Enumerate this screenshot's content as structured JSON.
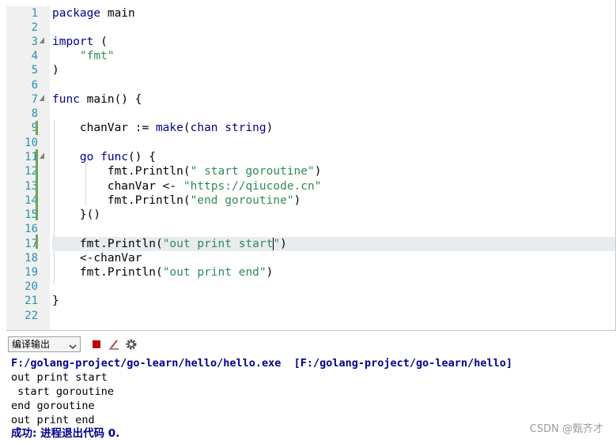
{
  "editor": {
    "line_numbers": [
      "1",
      "2",
      "3",
      "4",
      "5",
      "6",
      "7",
      "8",
      "9",
      "10",
      "11",
      "12",
      "13",
      "14",
      "15",
      "16",
      "17",
      "18",
      "19",
      "20",
      "21",
      "22"
    ],
    "line1": {
      "kw": "package",
      "rest": " main"
    },
    "line3": {
      "kw": "import",
      "rest": " ("
    },
    "line4": {
      "str": "\"fmt\""
    },
    "line5": ")",
    "line7": {
      "kw": "func",
      "rest": " main() {"
    },
    "line9": {
      "a": "chanVar := ",
      "b": "make",
      "c": "(",
      "d": "chan",
      "e": " ",
      "f": "string",
      "g": ")"
    },
    "line11": {
      "a": "go",
      "b": " ",
      "c": "func",
      "d": "() {"
    },
    "line12": {
      "a": "fmt.Println(",
      "s": "\" start goroutine\"",
      "b": ")"
    },
    "line13": {
      "a": "chanVar <- ",
      "s": "\"https://qiucode.cn\""
    },
    "line14": {
      "a": "fmt.Println(",
      "s": "\"end goroutine\"",
      "b": ")"
    },
    "line15": "}()",
    "line17": {
      "a": "fmt.Println(",
      "s1": "\"out print start",
      "s2": "\"",
      "b": ")"
    },
    "line18": "<-chanVar",
    "line19": {
      "a": "fmt.Println(",
      "s": "\"out print end\"",
      "b": ")"
    },
    "line21": "}"
  },
  "output_panel": {
    "selector_value": "编译输出",
    "lines": {
      "cmd": "F:/golang-project/go-learn/hello/hello.exe  [F:/golang-project/go-learn/hello]",
      "l1": "out print start",
      "l2": " start goroutine",
      "l3": "end goroutine",
      "l4": "out print end",
      "result": "成功: 进程退出代码 0."
    }
  },
  "watermark": "CSDN @甄齐才",
  "colors": {
    "keyword": "#00008b",
    "string": "#2e8b57",
    "line_number": "#2b91af",
    "change_bar": "#6aa84f",
    "stop": "#c00000"
  }
}
